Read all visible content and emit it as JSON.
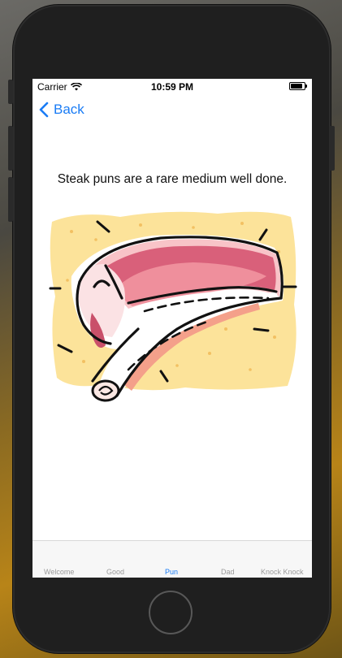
{
  "status_bar": {
    "carrier": "Carrier",
    "time": "10:59 PM",
    "battery_level": 0.9
  },
  "nav": {
    "back_label": "Back"
  },
  "content": {
    "pun": "Steak puns are a rare medium well done."
  },
  "tabs": [
    {
      "label": "Welcome",
      "active": false
    },
    {
      "label": "Good",
      "active": false
    },
    {
      "label": "Pun",
      "active": true
    },
    {
      "label": "Dad",
      "active": false
    },
    {
      "label": "Knock Knock",
      "active": false
    }
  ],
  "colors": {
    "accent": "#1a7cf5",
    "tab_inactive": "#9a9a9a",
    "device_frame": "#1f1f1f"
  },
  "icons": {
    "back": "chevron-left-icon",
    "wifi": "wifi-icon",
    "battery": "battery-icon",
    "home": "home-button"
  }
}
